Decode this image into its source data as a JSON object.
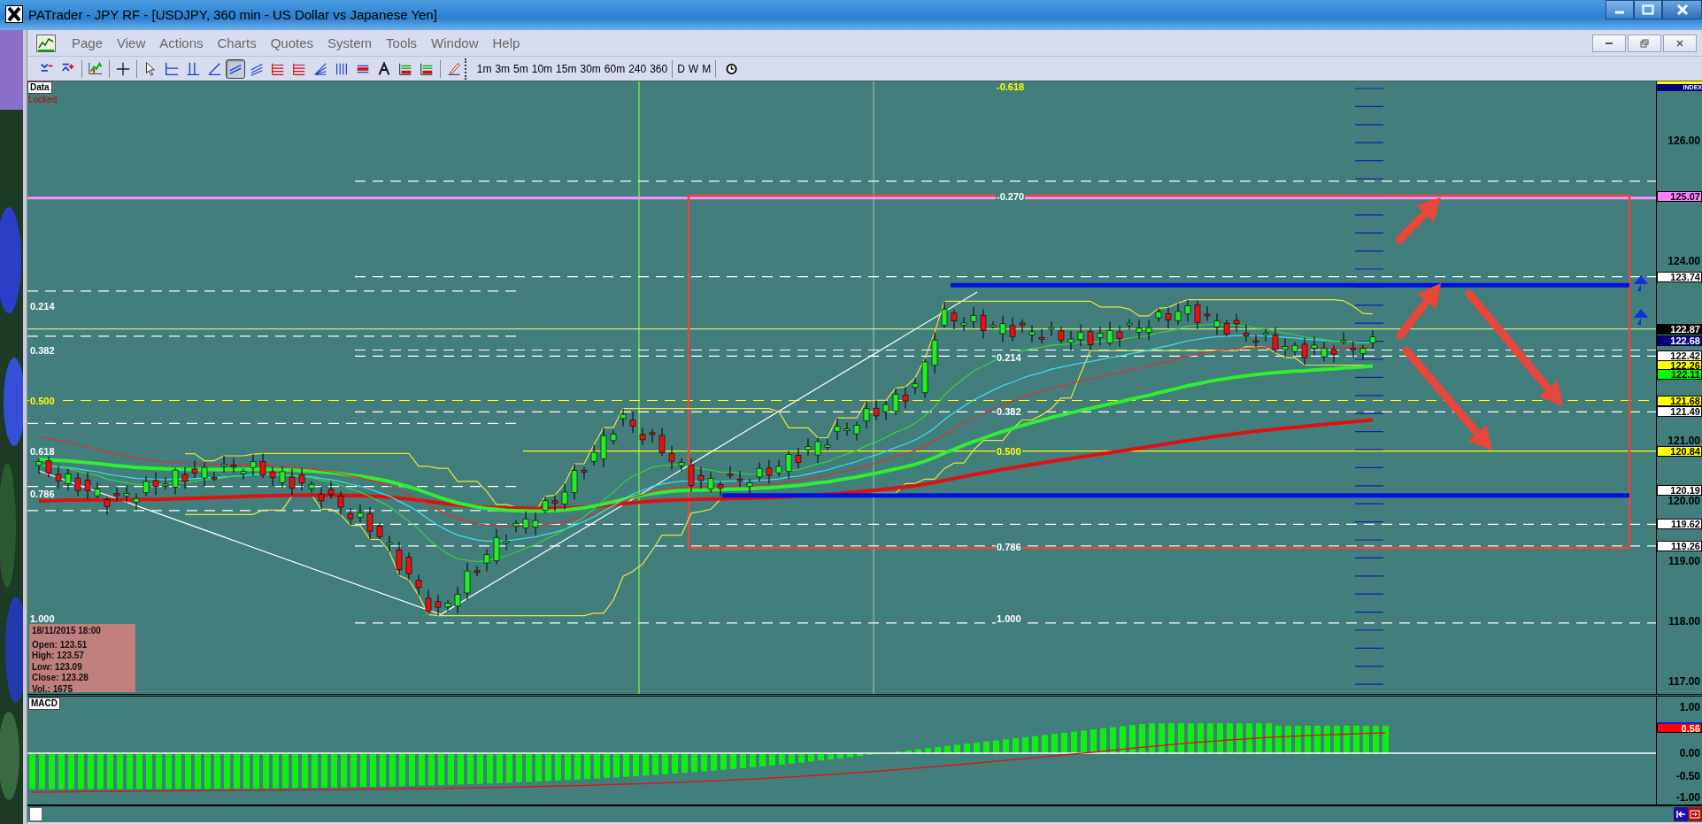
{
  "window": {
    "title": "PATrader - JPY RF - [USDJPY, 360 min - US Dollar vs Japanese Yen]"
  },
  "menu": [
    "Page",
    "View",
    "Actions",
    "Charts",
    "Quotes",
    "System",
    "Tools",
    "Window",
    "Help"
  ],
  "toolbar": {
    "tools": [
      {
        "kind": "zoom-out",
        "selected": false
      },
      {
        "kind": "zoom-in",
        "selected": false
      },
      {
        "kind": "indicator",
        "selected": false
      },
      {
        "kind": "crosshair",
        "selected": false
      },
      {
        "kind": "pointer",
        "selected": false
      },
      {
        "kind": "hline",
        "selected": false
      },
      {
        "kind": "vline",
        "selected": false
      },
      {
        "kind": "trendline",
        "selected": false
      },
      {
        "kind": "channel",
        "selected": true
      },
      {
        "kind": "regression",
        "selected": false
      },
      {
        "kind": "hlines",
        "selected": false
      },
      {
        "kind": "hlines",
        "selected": false
      },
      {
        "kind": "fan",
        "selected": false
      },
      {
        "kind": "vlines",
        "selected": false
      },
      {
        "kind": "bands",
        "selected": false
      },
      {
        "kind": "text",
        "selected": false
      },
      {
        "kind": "study",
        "selected": false
      },
      {
        "kind": "study",
        "selected": false
      },
      {
        "kind": "pen",
        "selected": false
      }
    ],
    "timeframes": [
      "1m",
      "3m",
      "5m",
      "10m",
      "15m",
      "30m",
      "60m",
      "240",
      "360"
    ],
    "periods": [
      "D",
      "W",
      "M"
    ]
  },
  "chart": {
    "data_label": "Data",
    "lock_label": "Locked",
    "fib_left": [
      {
        "label": "0.214",
        "color": "#ffffff"
      },
      {
        "label": "0.382",
        "color": "#ffffff"
      },
      {
        "label": "0.500",
        "color": "#ffff00"
      },
      {
        "label": "0.618",
        "color": "#ffffff"
      },
      {
        "label": "0.786",
        "color": "#ffffff"
      },
      {
        "label": "1.000",
        "color": "#ffffff"
      }
    ],
    "fib_mid": [
      {
        "label": "-0.618",
        "color": "#ffff00"
      },
      {
        "label": "-0.270",
        "color": "#ffffff"
      },
      {
        "label": "0.214",
        "color": "#ffffff"
      },
      {
        "label": "0.382",
        "color": "#ffffff"
      },
      {
        "label": "0.500",
        "color": "#ffff00"
      },
      {
        "label": "0.786",
        "color": "#ffffff"
      },
      {
        "label": "1.000",
        "color": "#ffffff"
      }
    ],
    "axis_labels": [
      "126.00",
      "124.00",
      "121.00",
      "120.00",
      "119.00",
      "118.00",
      "117.00"
    ],
    "index_label": "INDEX",
    "price_tags": [
      {
        "label": "125.07",
        "color": "#ff80ff"
      },
      {
        "label": "123.74",
        "color": "#ffffff"
      },
      {
        "label": "122.87",
        "color": "#000000"
      },
      {
        "label": "122.68",
        "color": "#000080"
      },
      {
        "label": "122.42",
        "color": "#ffffff"
      },
      {
        "label": "122.26",
        "color": "#ffff00"
      },
      {
        "label": "122.11",
        "color": "#00ff00"
      },
      {
        "label": "121.68",
        "color": "#ffff00"
      },
      {
        "label": "121.49",
        "color": "#ffffff"
      },
      {
        "label": "120.84",
        "color": "#ffff00"
      },
      {
        "label": "120.19",
        "color": "#ffffff"
      },
      {
        "label": "119.62",
        "color": "#ffffff"
      },
      {
        "label": "119.26",
        "color": "#ffffff"
      }
    ],
    "info_box": {
      "date": "18/11/2015 18:00",
      "lines": [
        "Open: 123.51",
        "High: 123.57",
        "Low: 123.09",
        "Close: 123.28",
        "Vol.: 1675"
      ]
    }
  },
  "macd": {
    "title": "MACD",
    "axis_labels": [
      "1.00",
      "0.00",
      "-0.50",
      "-1.00"
    ],
    "tag": {
      "label": "0.56",
      "color": "#ff0000"
    }
  }
}
